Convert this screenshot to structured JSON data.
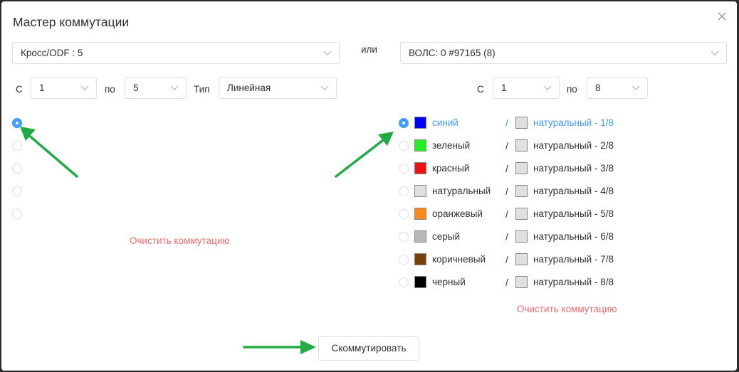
{
  "dialog": {
    "title": "Мастер коммутации"
  },
  "left": {
    "device_select": "Кросс/ODF : 5",
    "from_label": "С",
    "from_value": "1",
    "to_label": "по",
    "to_value": "5",
    "type_label": "Тип",
    "type_value": "Линейная",
    "ports": [
      {
        "selected": true
      },
      {
        "selected": false
      },
      {
        "selected": false
      },
      {
        "selected": false
      },
      {
        "selected": false
      }
    ],
    "clear_label": "Очистить коммутацию"
  },
  "or_label": "или",
  "right": {
    "cable_select": "ВОЛС: 0 #97165 (8)",
    "from_label": "С",
    "from_value": "1",
    "to_label": "по",
    "to_value": "8",
    "fibers": [
      {
        "color_name": "синий",
        "color": "#0000ff",
        "slash": "/",
        "tube_color": "#e0e0e0",
        "tube_label": "натуральный - 1/8",
        "selected": true
      },
      {
        "color_name": "зеленый",
        "color": "#22ee22",
        "slash": "/",
        "tube_color": "#e0e0e0",
        "tube_label": "натуральный - 2/8",
        "selected": false
      },
      {
        "color_name": "красный",
        "color": "#ee1111",
        "slash": "/",
        "tube_color": "#e0e0e0",
        "tube_label": "натуральный - 3/8",
        "selected": false
      },
      {
        "color_name": "натуральный",
        "color": "#e0e0e0",
        "slash": "/",
        "tube_color": "#e0e0e0",
        "tube_label": "натуральный - 4/8",
        "selected": false
      },
      {
        "color_name": "оранжевый",
        "color": "#ff8a1a",
        "slash": "/",
        "tube_color": "#e0e0e0",
        "tube_label": "натуральный - 5/8",
        "selected": false
      },
      {
        "color_name": "серый",
        "color": "#b8b8b8",
        "slash": "/",
        "tube_color": "#e0e0e0",
        "tube_label": "натуральный - 6/8",
        "selected": false
      },
      {
        "color_name": "коричневый",
        "color": "#7a3f0a",
        "slash": "/",
        "tube_color": "#e0e0e0",
        "tube_label": "натуральный - 7/8",
        "selected": false
      },
      {
        "color_name": "черный",
        "color": "#000000",
        "slash": "/",
        "tube_color": "#e0e0e0",
        "tube_label": "натуральный - 8/8",
        "selected": false
      }
    ],
    "clear_label": "Очистить коммутацию"
  },
  "submit_label": "Скоммутировать",
  "colors": {
    "accent": "#409eff",
    "danger": "#f06b6b",
    "annotation_arrow": "#22aa44"
  }
}
